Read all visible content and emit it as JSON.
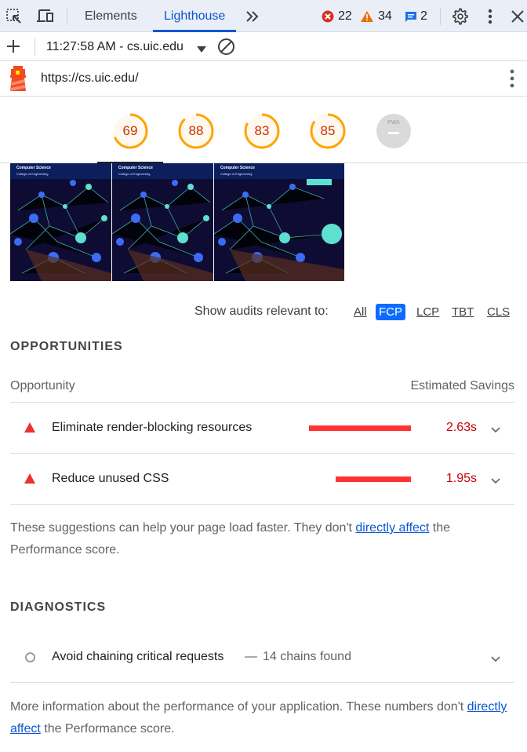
{
  "devtools": {
    "tabs": [
      {
        "label": "Elements",
        "active": false
      },
      {
        "label": "Lighthouse",
        "active": true
      }
    ],
    "more_tabs_icon": "chevron-double-right-icon",
    "counts": {
      "errors": "22",
      "warnings": "34",
      "messages": "2"
    },
    "colors": {
      "accent": "#0b57d0",
      "error": "#d93025",
      "warning": "#e8710a",
      "message": "#1a73e8"
    }
  },
  "toolbar": {
    "report_selector": "11:27:58 AM - cs.uic.edu"
  },
  "report": {
    "url": "https://cs.uic.edu/",
    "gauges": [
      {
        "name": "performance",
        "score": "69",
        "fraction": 0.69
      },
      {
        "name": "accessibility",
        "score": "88",
        "fraction": 0.88
      },
      {
        "name": "best-practices",
        "score": "83",
        "fraction": 0.83
      },
      {
        "name": "seo",
        "score": "85",
        "fraction": 0.85
      },
      {
        "name": "pwa",
        "label": "PWA",
        "score": null
      }
    ],
    "gauge_colors": {
      "average": "#ffa400",
      "average_text": "#c33300",
      "average_bg": "#fff8ee",
      "pwa_bg": "#dadada"
    },
    "filmstrip": [
      {
        "title": "Computer Science",
        "subtitle": "College of Engineering"
      },
      {
        "title": "Computer Science",
        "subtitle": "College of Engineering"
      },
      {
        "title": "Computer Science",
        "subtitle": "College of Engineering"
      }
    ],
    "filter": {
      "label": "Show audits relevant to:",
      "options": [
        "All",
        "FCP",
        "LCP",
        "TBT",
        "CLS"
      ],
      "selected": "FCP"
    },
    "opportunities": {
      "title": "OPPORTUNITIES",
      "col_opportunity": "Opportunity",
      "col_savings": "Estimated Savings",
      "items": [
        {
          "title": "Eliminate render-blocking resources",
          "savings": "2.63s",
          "savings_seconds": 2.63
        },
        {
          "title": "Reduce unused CSS",
          "savings": "1.95s",
          "savings_seconds": 1.95
        }
      ],
      "footer_before": "These suggestions can help your page load faster. They don't ",
      "footer_link": "directly affect",
      "footer_after": " the Performance score."
    },
    "diagnostics": {
      "title": "DIAGNOSTICS",
      "items": [
        {
          "title": "Avoid chaining critical requests",
          "separator": "—",
          "display": "14 chains found"
        }
      ],
      "footer_before": "More information about the performance of your application. These numbers don't ",
      "footer_link": "directly affect",
      "footer_after": " the Performance score."
    }
  }
}
